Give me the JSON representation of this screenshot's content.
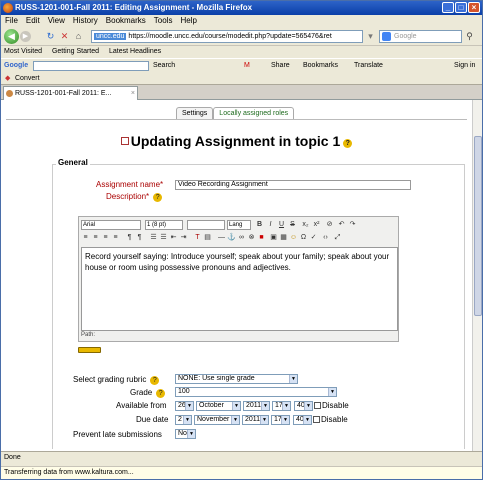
{
  "window": {
    "title": "RUSS-1201-001-Fall 2011: Editing Assignment - Mozilla Firefox"
  },
  "menu": [
    "File",
    "Edit",
    "View",
    "History",
    "Bookmarks",
    "Tools",
    "Help"
  ],
  "nav": {
    "site": "uncc.edu",
    "url": "https://moodle.uncc.edu/course/modedit.php?update=565476&ret",
    "search_placeholder": "Google"
  },
  "bookmarks": [
    "Most Visited",
    "Getting Started",
    "Latest Headlines"
  ],
  "toolbar2": {
    "brand": "Google",
    "search": "Search",
    "share": "Share",
    "bookmarks": "Bookmarks",
    "translate": "Translate",
    "signin": "Sign in"
  },
  "toolbar3": {
    "convert": "Convert"
  },
  "browser_tab": {
    "label": "RUSS-1201-001-Fall 2011: E..."
  },
  "settings_tabs": [
    "Settings",
    "Locally assigned roles"
  ],
  "page": {
    "heading": "Updating Assignment in topic 1",
    "legend": "General",
    "name_label": "Assignment name*",
    "name_value": "Video Recording Assignment",
    "desc_label": "Description*",
    "editor": {
      "font": "Arial",
      "size": "1 (8 pt)",
      "lang": "Lang",
      "text": "Record yourself saying: Introduce yourself; speak about your family; speak about your house or room using possessive pronouns and adjectives.",
      "path": "Path:"
    },
    "grading_label": "Select grading rubric",
    "grading_value": "NONE: Use single grade",
    "grade_label": "Grade",
    "grade_value": "100",
    "available_label": "Available from",
    "available": {
      "day": "26",
      "month": "October",
      "year": "2011",
      "hour": "17",
      "minute": "40"
    },
    "due_label": "Due date",
    "due": {
      "day": "2",
      "month": "November",
      "year": "2011",
      "hour": "17",
      "minute": "40"
    },
    "disable_label": "Disable",
    "late_label": "Prevent late submissions",
    "late_value": "No"
  },
  "status": {
    "done": "Done",
    "message": "Transferring data from www.kaltura.com..."
  }
}
